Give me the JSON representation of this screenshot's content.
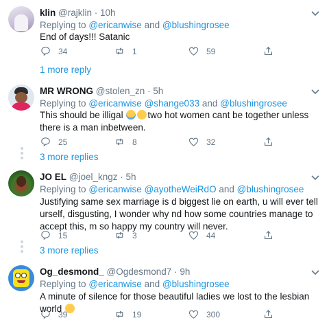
{
  "replying_prefix": "Replying to",
  "and": "and",
  "tweets": [
    {
      "name": "klin",
      "handle": "@rajklin",
      "time": "· 10h",
      "mentions": [
        "@ericanwise",
        "@blushingrosee"
      ],
      "text": "End of days!!! Satanic",
      "replies": "34",
      "retweets": "1",
      "likes": "59",
      "more": "1 more reply"
    },
    {
      "name": "MR WRONG",
      "handle": "@stolen_zn",
      "time": "· 5h",
      "mentions": [
        "@ericanwise",
        "@shange033",
        "@blushingrosee"
      ],
      "text_a": "This should be illigal",
      "text_b": "two hot women cant be together unless there is a man inbetween.",
      "replies": "25",
      "retweets": "8",
      "likes": "32",
      "more": "3 more replies"
    },
    {
      "name": "JO EL",
      "handle": "@joel_kngz",
      "time": "· 5h",
      "mentions": [
        "@ericanwise",
        "@ayotheWeiRdO",
        "@blushingrosee"
      ],
      "text": "Justifying same sex marriage is d biggest lie on earth, u will ever tell urself, disgusting, I wonder why nd how some countries manage to accept this, m so happy my country will never.",
      "replies": "15",
      "retweets": "3",
      "likes": "44",
      "more": "3 more replies"
    },
    {
      "name": "Og_desmond_",
      "handle": "@Ogdesmond7",
      "time": "· 9h",
      "mentions": [
        "@ericanwise",
        "@blushingrosee"
      ],
      "text": "A minute of silence for those beautiful ladies we lost to the lesbian world",
      "replies": "39",
      "retweets": "19",
      "likes": "300"
    }
  ]
}
